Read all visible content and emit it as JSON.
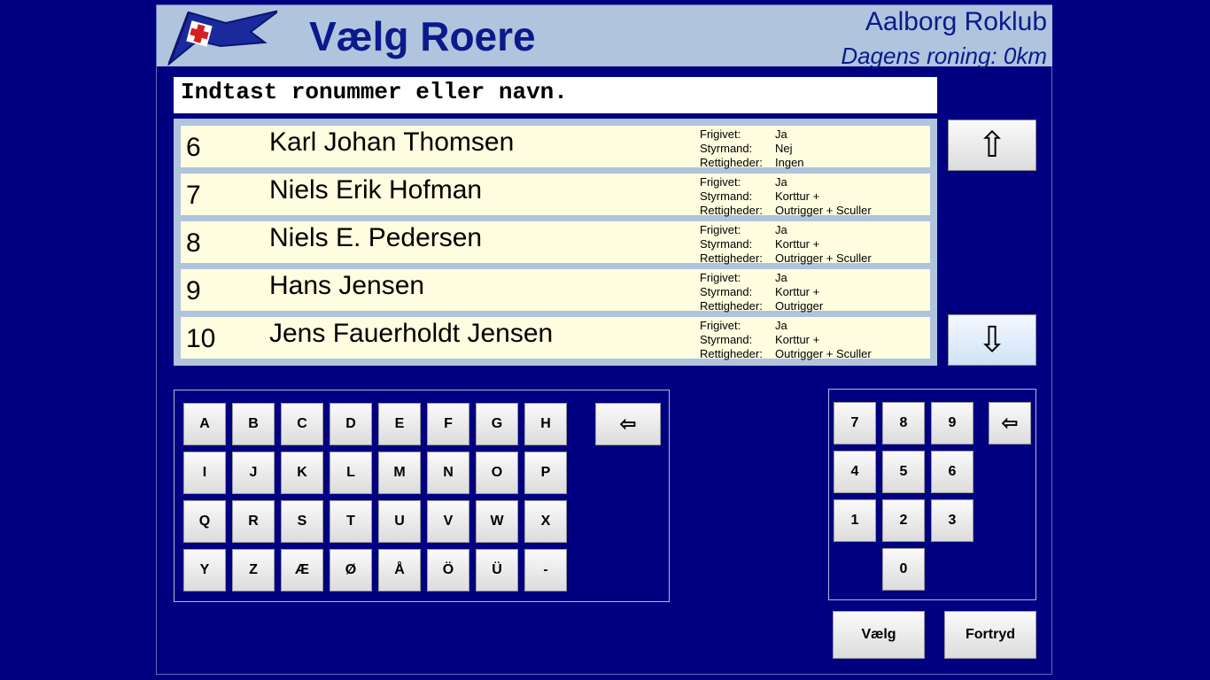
{
  "header": {
    "title": "Vælg Roere",
    "club": "Aalborg Roklub",
    "daily": "Dagens roning: 0km"
  },
  "search": {
    "text": "Indtast ronummer eller navn."
  },
  "rowers": [
    {
      "num": "6",
      "name": "Karl Johan Thomsen",
      "frigivet": "Ja",
      "styrmand": "Nej",
      "rettigheder": "Ingen"
    },
    {
      "num": "7",
      "name": "Niels Erik Hofman",
      "frigivet": "Ja",
      "styrmand": "Korttur +",
      "rettigheder": "Outrigger + Sculler"
    },
    {
      "num": "8",
      "name": "Niels E. Pedersen",
      "frigivet": "Ja",
      "styrmand": "Korttur +",
      "rettigheder": "Outrigger + Sculler"
    },
    {
      "num": "9",
      "name": "Hans Jensen",
      "frigivet": "Ja",
      "styrmand": "Korttur +",
      "rettigheder": "Outrigger"
    },
    {
      "num": "10",
      "name": "Jens Fauerholdt Jensen",
      "frigivet": "Ja",
      "styrmand": "Korttur +",
      "rettigheder": "Outrigger + Sculler"
    }
  ],
  "info_labels": {
    "frigivet": "Frigivet:",
    "styrmand": "Styrmand:",
    "rettigheder": "Rettigheder:"
  },
  "scroll": {
    "up": "⇧",
    "down": "⇩"
  },
  "keyboard": {
    "rows": [
      [
        "A",
        "B",
        "C",
        "D",
        "E",
        "F",
        "G",
        "H"
      ],
      [
        "I",
        "J",
        "K",
        "L",
        "M",
        "N",
        "O",
        "P"
      ],
      [
        "Q",
        "R",
        "S",
        "T",
        "U",
        "V",
        "W",
        "X"
      ],
      [
        "Y",
        "Z",
        "Æ",
        "Ø",
        "Å",
        "Ö",
        "Ü",
        "-"
      ]
    ],
    "backspace": "⇦"
  },
  "numpad": {
    "rows": [
      [
        "7",
        "8",
        "9"
      ],
      [
        "4",
        "5",
        "6"
      ],
      [
        "1",
        "2",
        "3"
      ]
    ],
    "zero": "0",
    "backspace": "⇦"
  },
  "actions": {
    "select": "Vælg",
    "cancel": "Fortryd"
  },
  "colors": {
    "background": "#000080",
    "header": "#b0c4de",
    "row": "#fffde0",
    "title": "#0a1a8c"
  }
}
